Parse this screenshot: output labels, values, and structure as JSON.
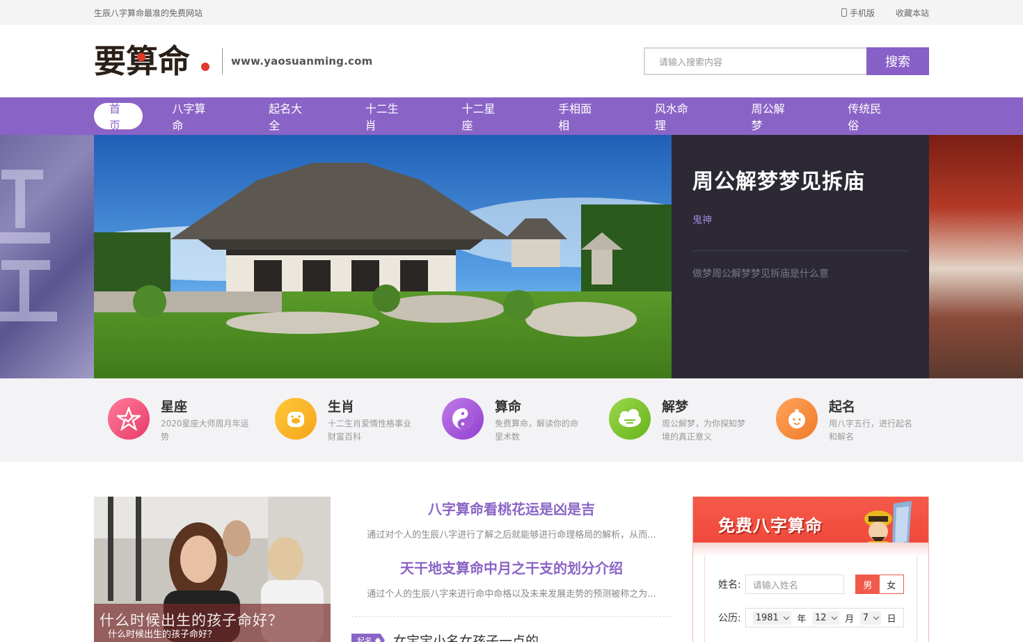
{
  "topbar": {
    "slogan": "生辰八字算命最准的免费网站",
    "mobile_label": "手机版",
    "bookmark_label": "收藏本站"
  },
  "header": {
    "logo_text": "要算命",
    "domain": "www.yaosuanming.com",
    "search_placeholder": "请输入搜索内容",
    "search_button": "搜索"
  },
  "nav": {
    "items": [
      "首页",
      "八字算命",
      "起名大全",
      "十二生肖",
      "十二星座",
      "手相面相",
      "风水命理",
      "周公解梦",
      "传统民俗"
    ],
    "active_index": 0
  },
  "banner": {
    "title": "周公解梦梦见拆庙",
    "author": "鬼神",
    "description": "做梦周公解梦梦见拆庙是什么意"
  },
  "categories": [
    {
      "title": "星座",
      "desc": "2020星座大师周月年运势",
      "icon": "star-icon",
      "color": "#f0507a"
    },
    {
      "title": "生肖",
      "desc": "十二生肖爱情性格事业财富百科",
      "icon": "pig-icon",
      "color": "#f5b324"
    },
    {
      "title": "算命",
      "desc": "免费算命，解读你的命里术数",
      "icon": "yin-yang-icon",
      "color": "#a55ad8"
    },
    {
      "title": "解梦",
      "desc": "周公解梦，为你探知梦境的真正意义",
      "icon": "cloud-icon",
      "color": "#7cc42c"
    },
    {
      "title": "起名",
      "desc": "用八字五行，进行起名和解名",
      "icon": "baby-face-icon",
      "color": "#f58a3c"
    }
  ],
  "feature": {
    "overlay_text": "什么时候出生的孩子命好？",
    "caption": "什么时候出生的孩子命好？"
  },
  "articles": [
    {
      "title": "八字算命看桃花运是凶是吉",
      "desc": "通过对个人的生辰八字进行了解之后就能够进行命理格局的解析，从而..."
    },
    {
      "title": "天干地支算命中月之干支的划分介绍",
      "desc": "通过个人的生辰八字来进行命中命格以及未来发展走势的预测被称之为..."
    }
  ],
  "list": [
    {
      "tag": "起名",
      "title": "女宝宝小名女孩子一点的"
    }
  ],
  "widget": {
    "title": "免费八字算命",
    "name_label": "姓名:",
    "name_placeholder": "请输入姓名",
    "gender_male": "男",
    "gender_female": "女",
    "date_label": "公历:",
    "year": "1981",
    "year_unit": "年",
    "month": "12",
    "month_unit": "月",
    "day": "7",
    "day_unit": "日"
  },
  "colors": {
    "brand_purple": "#8a63c6",
    "banner_dark": "#2c2935",
    "widget_red": "#f0493b"
  }
}
